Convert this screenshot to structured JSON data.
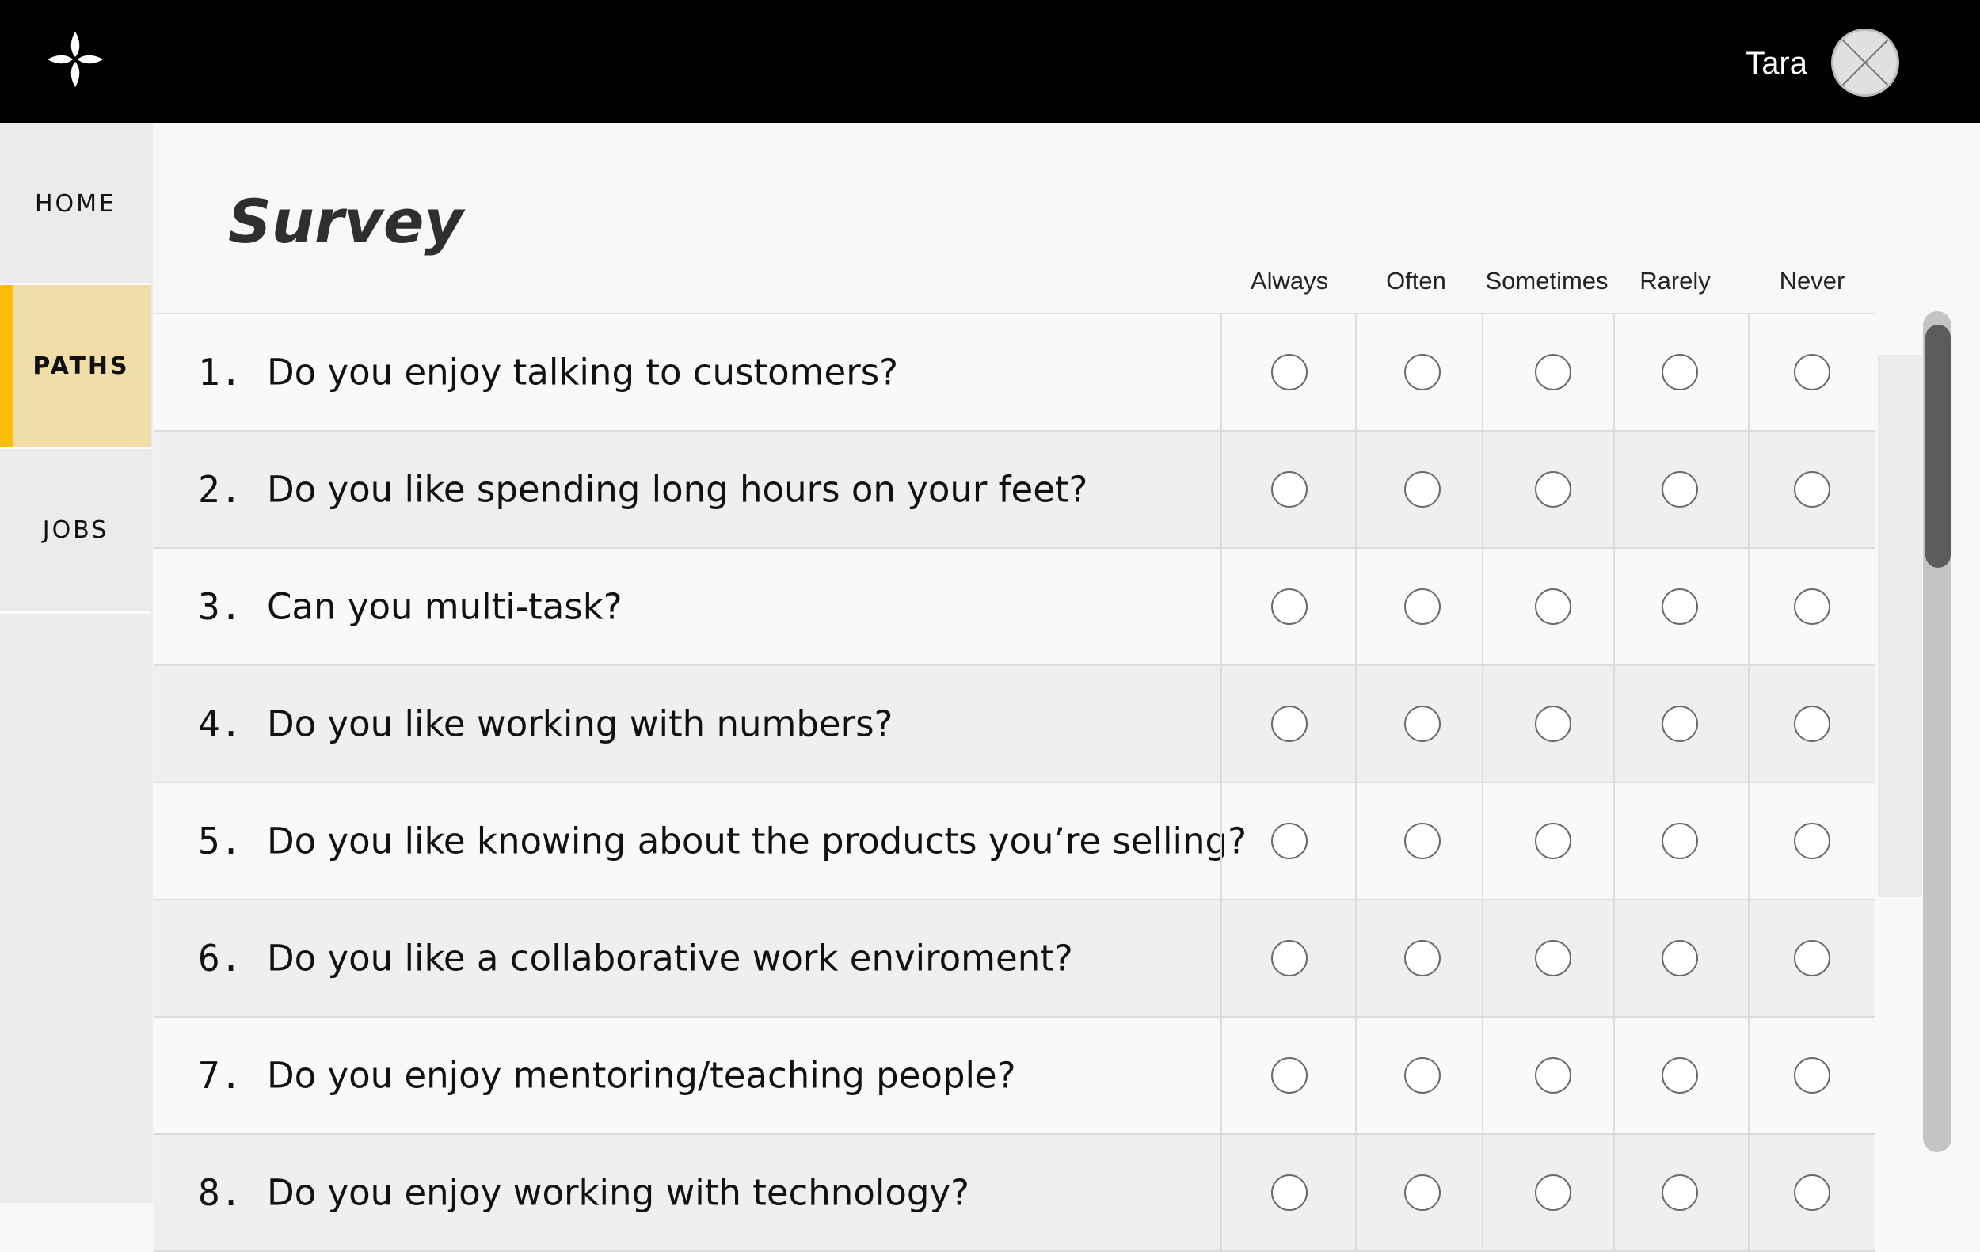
{
  "header": {
    "logo_icon": "four-petal-star-icon",
    "user_name": "Tara",
    "avatar_icon": "avatar-placeholder-icon"
  },
  "sidebar": {
    "items": [
      {
        "label": "HOME",
        "active": false
      },
      {
        "label": "PATHS",
        "active": true
      },
      {
        "label": "JOBS",
        "active": false
      }
    ],
    "accent_color": "#fbbd0a",
    "active_bg": "#f1dda7"
  },
  "survey": {
    "title": "Survey",
    "options": [
      "Always",
      "Often",
      "Sometimes",
      "Rarely",
      "Never"
    ],
    "questions": [
      {
        "num": "1.",
        "text": "Do you enjoy talking to customers?"
      },
      {
        "num": "2.",
        "text": "Do you like spending long hours on your feet?"
      },
      {
        "num": "3.",
        "text": "Can you multi-task?"
      },
      {
        "num": "4.",
        "text": "Do you like working with numbers?"
      },
      {
        "num": "5.",
        "text": "Do you like knowing about the products you’re selling?"
      },
      {
        "num": "6.",
        "text": "Do you like a collaborative work enviroment?"
      },
      {
        "num": "7.",
        "text": "Do you enjoy mentoring/teaching people?"
      },
      {
        "num": "8.",
        "text": "Do you enjoy working with technology?"
      }
    ]
  }
}
